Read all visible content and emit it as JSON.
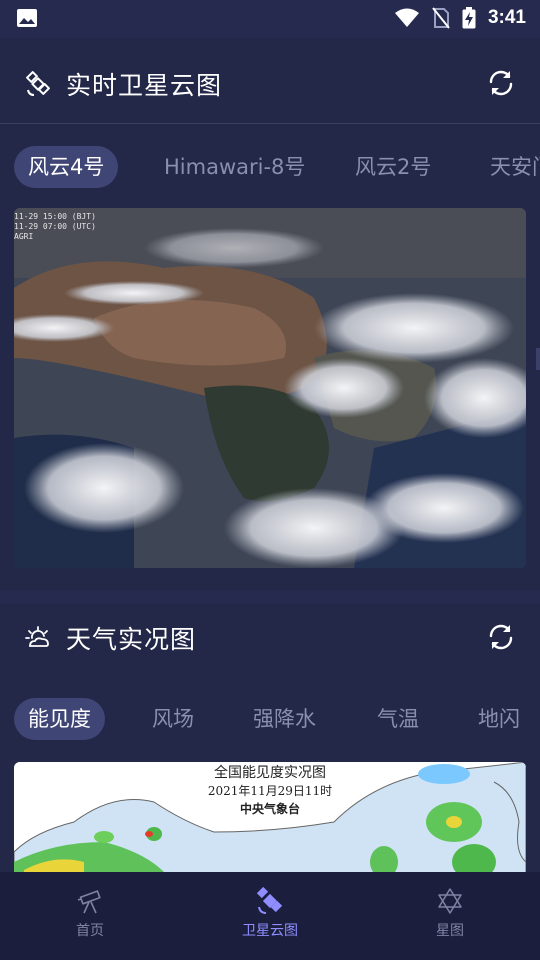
{
  "status_bar": {
    "time": "3:41",
    "left_icon": "image-notification-icon",
    "icons": [
      "wifi-icon",
      "no-sim-icon",
      "battery-charging-icon"
    ]
  },
  "satellite_section": {
    "title": "实时卫星云图",
    "title_icon": "satellite-outline-icon",
    "refresh_icon": "refresh-icon",
    "tabs": [
      "风云4号",
      "Himawari-8号",
      "风云2号",
      "天安门"
    ],
    "active_tab": 0,
    "image_stamp": [
      "11-29 15:00 (BJT)",
      "11-29 07:00 (UTC)",
      "AGRI"
    ]
  },
  "weather_section": {
    "title": "天气实况图",
    "title_icon": "sun-cloud-icon",
    "refresh_icon": "refresh-icon",
    "tabs": [
      "能见度",
      "风场",
      "强降水",
      "气温",
      "地闪"
    ],
    "active_tab": 0,
    "map_title": "全国能见度实况图",
    "map_date": "2021年11月29日11时",
    "map_source": "中央气象台"
  },
  "bottom_nav": {
    "items": [
      {
        "label": "首页",
        "icon": "telescope-icon"
      },
      {
        "label": "卫星云图",
        "icon": "satellite-icon"
      },
      {
        "label": "星图",
        "icon": "star-of-david-icon"
      }
    ],
    "active": 1
  },
  "colors": {
    "background": "#252a4e",
    "card": "#232748",
    "active_tab": "#3f4575",
    "inactive_text": "#8a8fae",
    "nav_active": "#8f8dff",
    "nav_background": "#1b1f3d"
  }
}
